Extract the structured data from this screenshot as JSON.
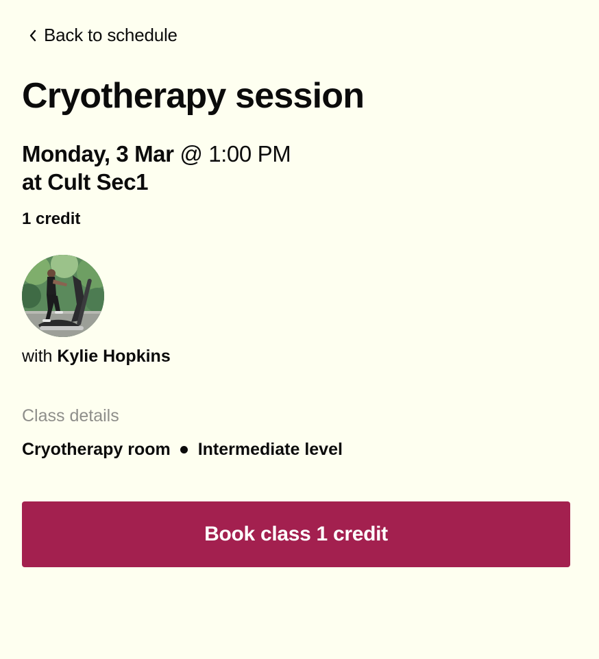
{
  "nav": {
    "back_label": "Back to schedule",
    "back_icon": "chevron-left-icon"
  },
  "session": {
    "title": "Cryotherapy session",
    "day": "Monday, 3 Mar",
    "time": " @ 1:00 PM",
    "location": "at Cult Sec1",
    "credit": "1 credit"
  },
  "instructor": {
    "prefix": "with ",
    "name": "Kylie Hopkins"
  },
  "details": {
    "heading": "Class details",
    "room": "Cryotherapy room",
    "level": "Intermediate level"
  },
  "actions": {
    "book_label": "Book class 1 credit"
  },
  "colors": {
    "background": "#fefff0",
    "accent": "#a3204f",
    "muted_text": "#8e8e8a"
  }
}
